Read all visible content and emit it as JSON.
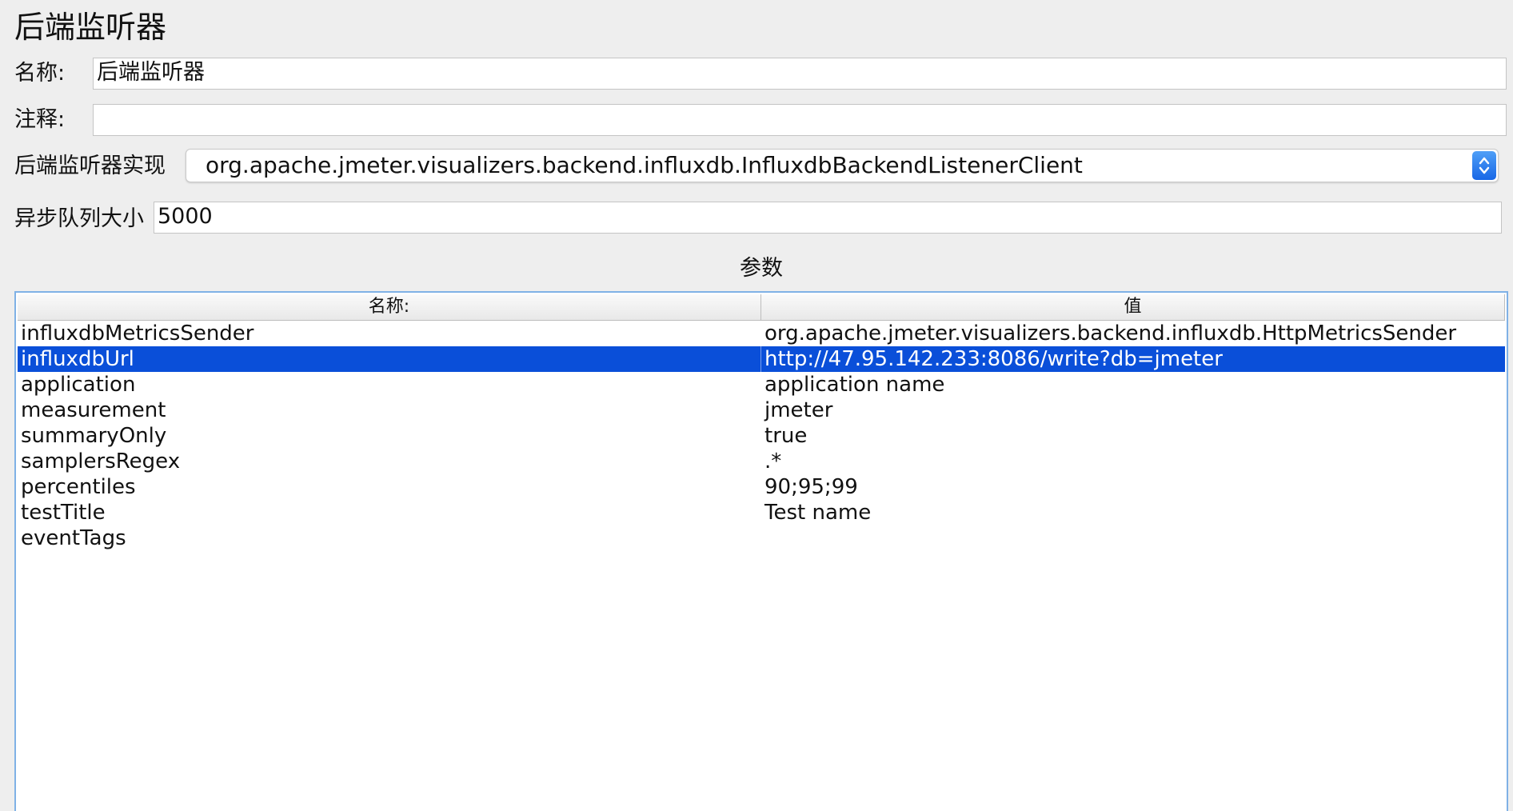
{
  "header": {
    "title": "后端监听器"
  },
  "form": {
    "name_label": "名称:",
    "name_value": "后端监听器",
    "comment_label": "注释:",
    "comment_value": "",
    "impl_label": "后端监听器实现",
    "impl_value": "org.apache.jmeter.visualizers.backend.influxdb.InfluxdbBackendListenerClient",
    "queue_label": "异步队列大小",
    "queue_value": "5000"
  },
  "parameters": {
    "title": "参数",
    "columns": [
      "名称:",
      "值"
    ],
    "rows": [
      {
        "name": "influxdbMetricsSender",
        "value": "org.apache.jmeter.visualizers.backend.influxdb.HttpMetricsSender",
        "selected": false
      },
      {
        "name": "influxdbUrl",
        "value": "http://47.95.142.233:8086/write?db=jmeter",
        "selected": true
      },
      {
        "name": "application",
        "value": "application name",
        "selected": false
      },
      {
        "name": "measurement",
        "value": "jmeter",
        "selected": false
      },
      {
        "name": "summaryOnly",
        "value": "true",
        "selected": false
      },
      {
        "name": "samplersRegex",
        "value": ".*",
        "selected": false
      },
      {
        "name": "percentiles",
        "value": "90;95;99",
        "selected": false
      },
      {
        "name": "testTitle",
        "value": "Test name",
        "selected": false
      },
      {
        "name": "eventTags",
        "value": "",
        "selected": false
      }
    ]
  },
  "theme": {
    "selection_color": "#0a4fd9",
    "accent_color": "#1867e6",
    "table_border_color": "#7fb1e6"
  },
  "icons": {
    "select_arrows": "chevron-up-down-icon"
  }
}
